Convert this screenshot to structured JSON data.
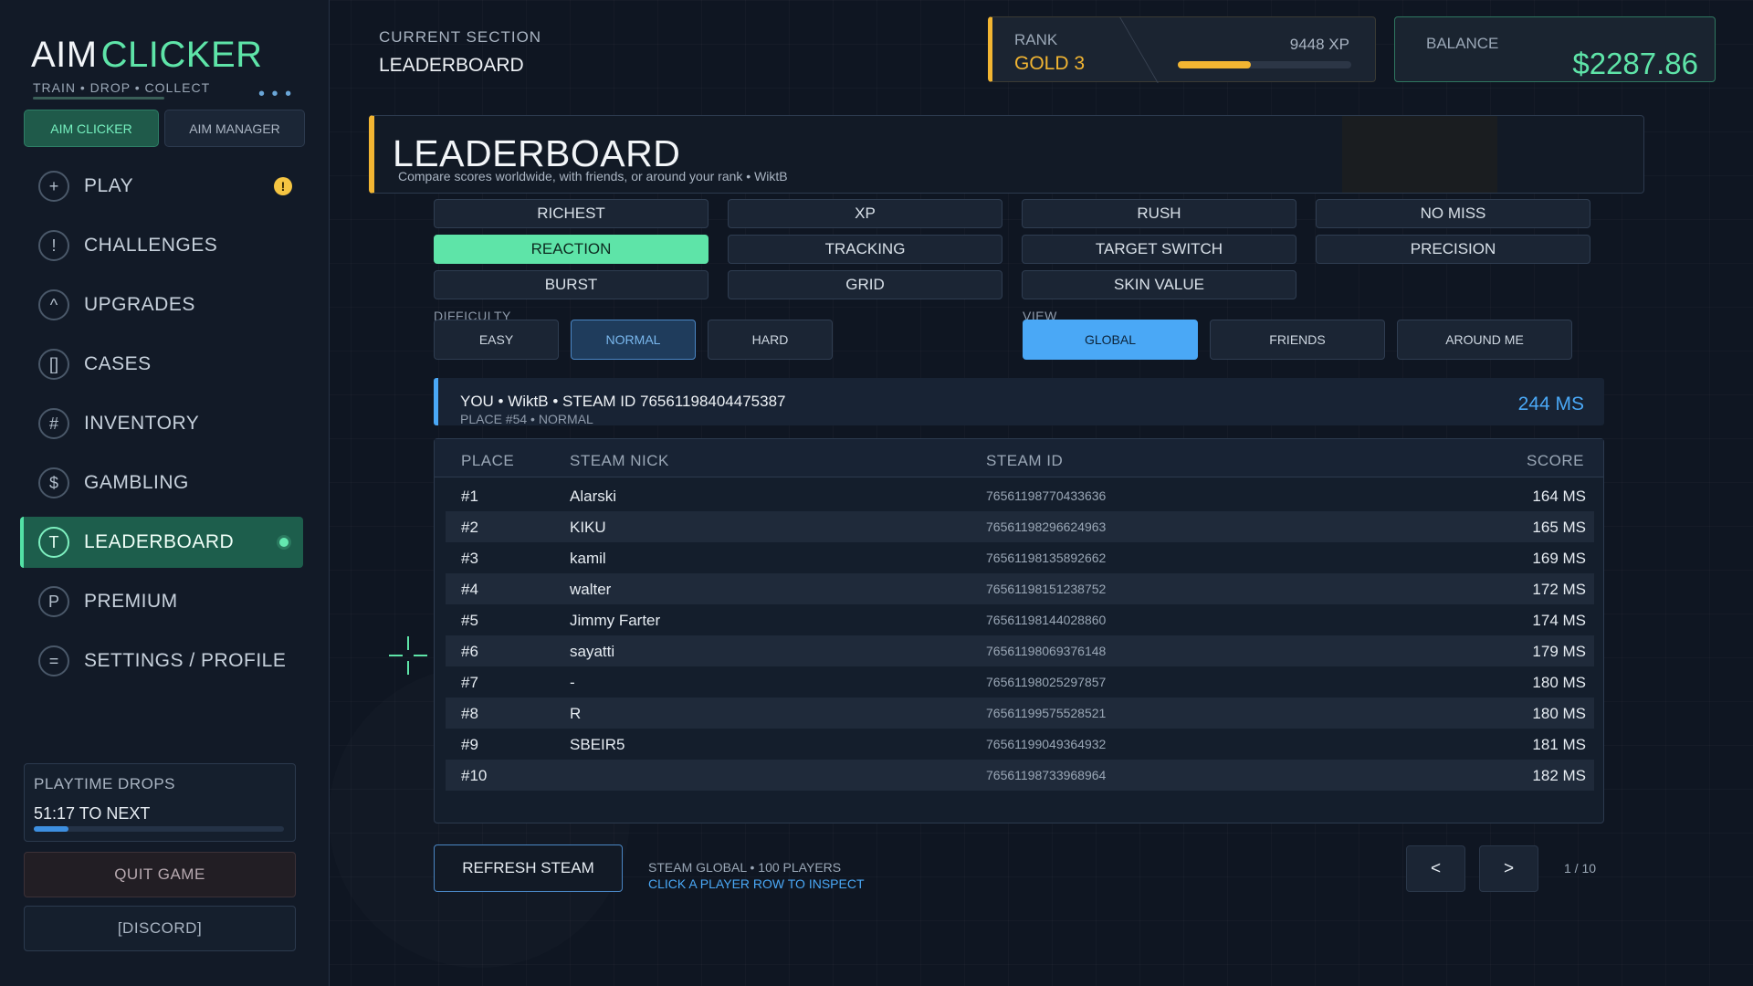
{
  "colors": {
    "accent_green": "#5ee4a8",
    "accent_blue": "#4aa8f6",
    "accent_gold": "#f2b532",
    "background": "#0f1622"
  },
  "sidebar": {
    "logo_part1": "AIM",
    "logo_part2": "CLICKER",
    "tagline": "TRAIN  •  DROP  •  COLLECT",
    "logo_dots": "• • •",
    "mode_tabs": [
      {
        "label": "AIM CLICKER",
        "active": true
      },
      {
        "label": "AIM MANAGER",
        "active": false
      }
    ],
    "nav": [
      {
        "icon_glyph": "+",
        "icon": "plus-icon",
        "label": "PLAY",
        "alert": "!"
      },
      {
        "icon_glyph": "!",
        "icon": "exclamation-icon",
        "label": "CHALLENGES"
      },
      {
        "icon_glyph": "^",
        "icon": "caret-up-icon",
        "label": "UPGRADES"
      },
      {
        "icon_glyph": "[]",
        "icon": "brackets-icon",
        "label": "CASES"
      },
      {
        "icon_glyph": "#",
        "icon": "hash-icon",
        "label": "INVENTORY"
      },
      {
        "icon_glyph": "$",
        "icon": "dollar-icon",
        "label": "GAMBLING"
      },
      {
        "icon_glyph": "T",
        "icon": "trophy-t-icon",
        "label": "LEADERBOARD",
        "active": true
      },
      {
        "icon_glyph": "P",
        "icon": "premium-p-icon",
        "label": "PREMIUM"
      },
      {
        "icon_glyph": "=",
        "icon": "equals-icon",
        "label": "SETTINGS / PROFILE"
      }
    ],
    "playtime": {
      "title": "PLAYTIME DROPS",
      "value": "51:17 TO NEXT",
      "progress": 0.14
    },
    "quit_label": "QUIT GAME",
    "discord_label": "[DISCORD]"
  },
  "header": {
    "current_section_label": "CURRENT SECTION",
    "current_section_value": "LEADERBOARD",
    "rank_label": "RANK",
    "rank_value": "GOLD 3",
    "xp_text": "9448 XP",
    "xp_progress": 0.42,
    "balance_label": "BALANCE",
    "balance_value": "$2287.86"
  },
  "main": {
    "title": "LEADERBOARD",
    "subtitle": "Compare scores worldwide, with friends, or around your rank  •  WiktB",
    "categories": [
      {
        "label": "RICHEST",
        "active": false
      },
      {
        "label": "XP",
        "active": false
      },
      {
        "label": "RUSH",
        "active": false
      },
      {
        "label": "NO MISS",
        "active": false
      },
      {
        "label": "REACTION",
        "active": true
      },
      {
        "label": "TRACKING",
        "active": false
      },
      {
        "label": "TARGET SWITCH",
        "active": false
      },
      {
        "label": "PRECISION",
        "active": false
      },
      {
        "label": "BURST",
        "active": false
      },
      {
        "label": "GRID",
        "active": false
      },
      {
        "label": "SKIN VALUE",
        "active": false
      }
    ],
    "difficulty_label": "DIFFICULTY",
    "difficulty": [
      {
        "label": "EASY",
        "active": false
      },
      {
        "label": "NORMAL",
        "active": true
      },
      {
        "label": "HARD",
        "active": false
      }
    ],
    "view_label": "VIEW",
    "view": [
      {
        "label": "GLOBAL",
        "active": true
      },
      {
        "label": "FRIENDS",
        "active": false
      },
      {
        "label": "AROUND ME",
        "active": false
      }
    ],
    "you": {
      "main": "YOU  •  WiktB  •  STEAM ID 76561198404475387",
      "sub": "PLACE #54  •  NORMAL",
      "score": "244 MS"
    },
    "table": {
      "headers": {
        "place": "PLACE",
        "nick": "STEAM NICK",
        "id": "STEAM ID",
        "score": "SCORE"
      },
      "rows": [
        {
          "place": "#1",
          "nick": "Alarski",
          "id": "76561198770433636",
          "score": "164 MS"
        },
        {
          "place": "#2",
          "nick": "KIKU",
          "id": "76561198296624963",
          "score": "165 MS"
        },
        {
          "place": "#3",
          "nick": "kamil",
          "id": "76561198135892662",
          "score": "169 MS"
        },
        {
          "place": "#4",
          "nick": "walter",
          "id": "76561198151238752",
          "score": "172 MS"
        },
        {
          "place": "#5",
          "nick": "Jimmy Farter",
          "id": "76561198144028860",
          "score": "174 MS"
        },
        {
          "place": "#6",
          "nick": "sayatti",
          "id": "76561198069376148",
          "score": "179 MS"
        },
        {
          "place": "#7",
          "nick": "-",
          "id": "76561198025297857",
          "score": "180 MS"
        },
        {
          "place": "#8",
          "nick": "R",
          "id": "76561199575528521",
          "score": "180 MS"
        },
        {
          "place": "#9",
          "nick": "SBEIR5",
          "id": "76561199049364932",
          "score": "181 MS"
        },
        {
          "place": "#10",
          "nick": "",
          "id": "76561198733968964",
          "score": "182 MS"
        }
      ]
    },
    "refresh_label": "REFRESH STEAM",
    "footer_info": "STEAM GLOBAL • 100 PLAYERS",
    "footer_hint": "CLICK A PLAYER ROW TO INSPECT",
    "prev_label": "<",
    "next_label": ">",
    "page_indicator": "1 / 10"
  }
}
